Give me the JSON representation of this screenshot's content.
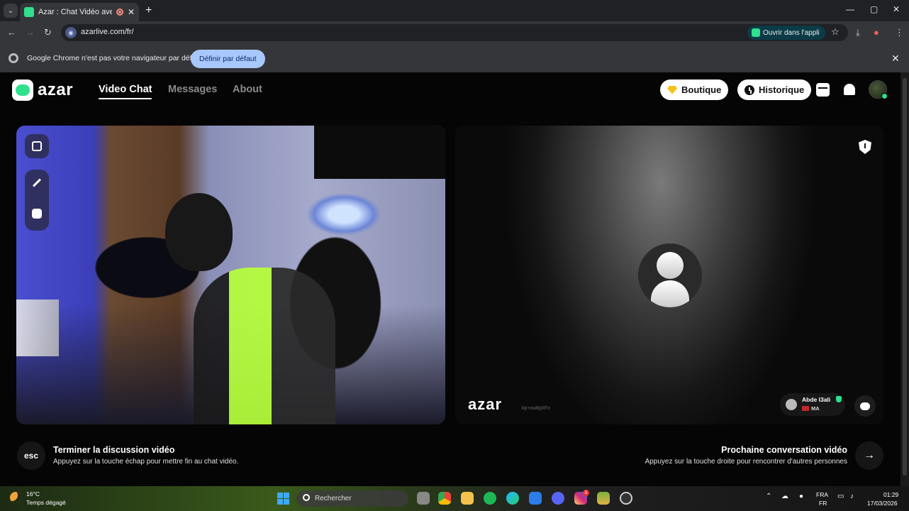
{
  "browser": {
    "tab_title": "Azar : Chat Vidéo avec de n",
    "url": "azarlive.com/fr/",
    "open_app_label": "Ouvrir dans l'appli",
    "infobar_text": "Google Chrome n'est pas votre navigateur par défaut",
    "infobar_button": "Définir par défaut"
  },
  "header": {
    "logo_text": "azar",
    "nav": [
      "Video Chat",
      "Messages",
      "About"
    ],
    "active_nav": "Video Chat",
    "shop_label": "Boutique",
    "history_label": "Historique"
  },
  "remote": {
    "watermark": "azar",
    "session_id": "kp+ou8qXFo",
    "peer_name": "Abde l3ali",
    "peer_country": "MA"
  },
  "hints": {
    "esc_key": "esc",
    "end_title": "Terminer la discussion vidéo",
    "end_sub": "Appuyez sur la touche échap pour mettre fin au chat vidéo.",
    "next_title": "Prochaine conversation vidéo",
    "next_sub": "Appuyez sur la touche droite pour rencontrer d'autres personnes",
    "next_icon": "→"
  },
  "taskbar": {
    "temperature": "16°C",
    "weather": "Temps dégagé",
    "search_placeholder": "Rechercher",
    "lang_top": "FRA",
    "lang_bottom": "FR",
    "time": "01:29",
    "date": "17/03/2026",
    "instagram_badge": "5"
  },
  "colors": {
    "brand_green": "#2fe08c",
    "infobar_button": "#a8c7fa",
    "gem": "#f6c31c"
  }
}
